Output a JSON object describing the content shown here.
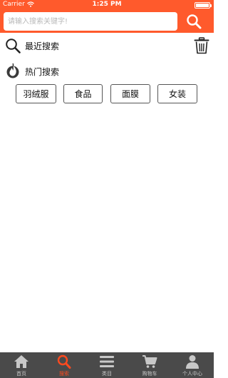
{
  "status_bar": {
    "carrier": "Carrier",
    "time": "1:25 PM"
  },
  "search": {
    "placeholder": "请输入搜索关键字!",
    "value": ""
  },
  "recent": {
    "label": "最近搜索"
  },
  "hot": {
    "label": "热门搜索",
    "tags": [
      "羽绒服",
      "食品",
      "面膜",
      "女装"
    ]
  },
  "tabbar": {
    "active_color": "#ff4a1f",
    "items": [
      {
        "label": "首页",
        "icon": "home-icon"
      },
      {
        "label": "搜索",
        "icon": "search-icon"
      },
      {
        "label": "类目",
        "icon": "menu-icon"
      },
      {
        "label": "购物车",
        "icon": "cart-icon"
      },
      {
        "label": "个人中心",
        "icon": "person-icon"
      }
    ]
  },
  "colors": {
    "brand": "#ff5a2c",
    "tabbar_bg": "#4a4a4a"
  }
}
